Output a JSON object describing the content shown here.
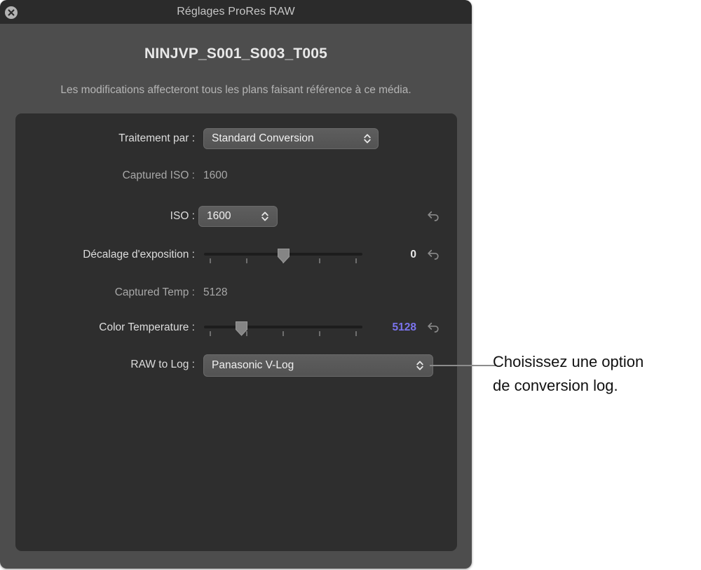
{
  "window": {
    "title": "Réglages ProRes RAW",
    "close_icon": "close-icon"
  },
  "header": {
    "clip_name": "NINJVP_S001_S003_T005",
    "subtitle": "Les modifications affecteront tous les plans faisant référence à ce média."
  },
  "colors": {
    "accent_value": "#7b74ee",
    "label": "#dcdcdc",
    "dim_label": "#a8a8a8",
    "panel_bg": "#2e2e2e",
    "window_bg": "#4d4d4d",
    "titlebar_bg": "#2b2b2b"
  },
  "fields": {
    "processing": {
      "label": "Traitement par :",
      "value": "Standard Conversion",
      "control": "popup-button"
    },
    "captured_iso": {
      "label": "Captured ISO :",
      "value": "1600",
      "control": "static-text"
    },
    "iso": {
      "label": "ISO :",
      "value": "1600",
      "control": "popup-button",
      "reset_icon": "undo-arrow-icon"
    },
    "exposure_offset": {
      "label": "Décalage d'exposition :",
      "value": "0",
      "control": "slider",
      "thumb_percent": 50,
      "tick_percents": [
        4,
        27,
        50,
        73,
        96
      ],
      "reset_icon": "undo-arrow-icon"
    },
    "captured_temp": {
      "label": "Captured Temp :",
      "value": "5128",
      "control": "static-text"
    },
    "color_temperature": {
      "label": "Color Temperature :",
      "value": "5128",
      "control": "slider",
      "thumb_percent": 23,
      "tick_percents": [
        4,
        27,
        50,
        73,
        96
      ],
      "reset_icon": "undo-arrow-icon"
    },
    "raw_to_log": {
      "label": "RAW to Log :",
      "value": "Panasonic V-Log",
      "control": "popup-button"
    }
  },
  "annotation": {
    "line1": "Choisissez une option",
    "line2": "de conversion log."
  }
}
